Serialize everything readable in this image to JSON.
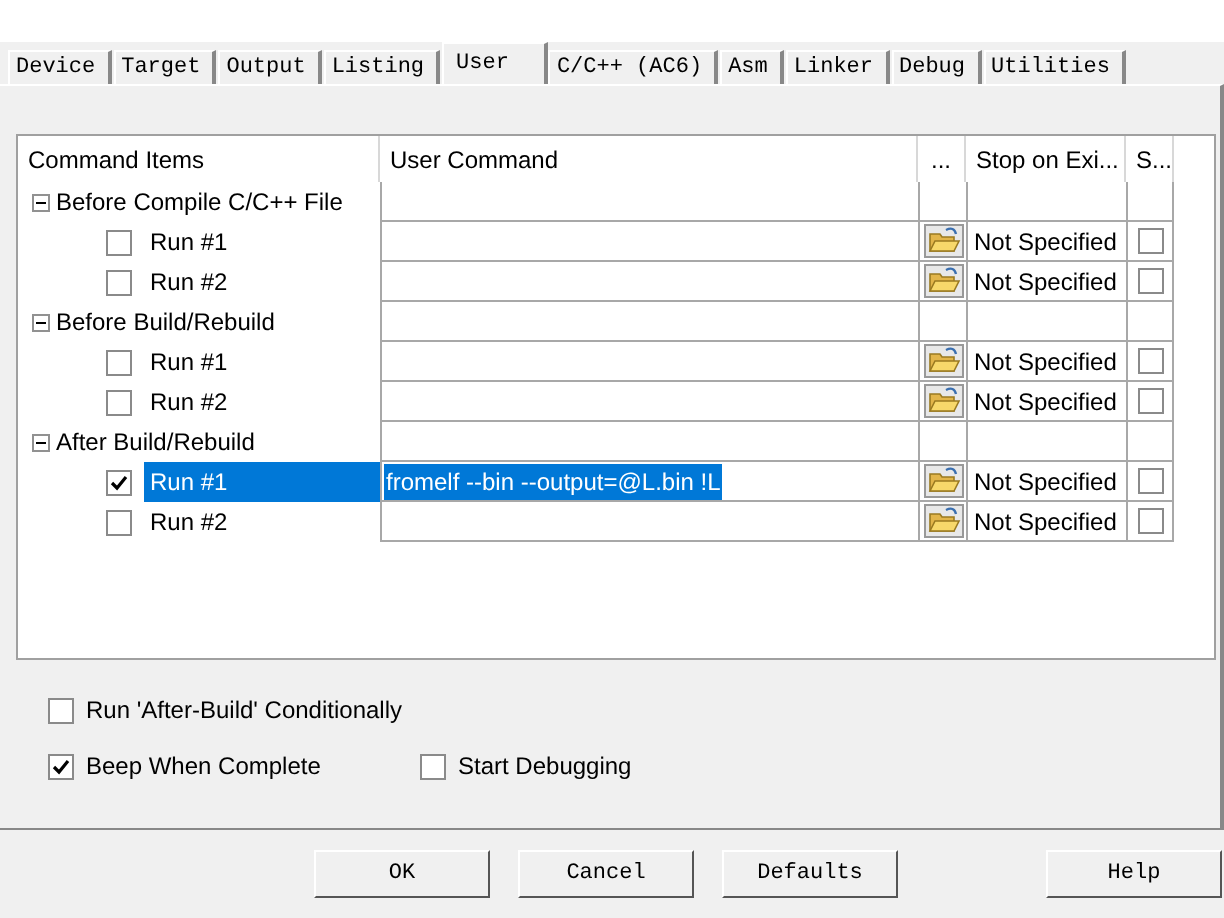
{
  "tabs": [
    {
      "label": "Device",
      "selected": false
    },
    {
      "label": "Target",
      "selected": false
    },
    {
      "label": "Output",
      "selected": false
    },
    {
      "label": "Listing",
      "selected": false
    },
    {
      "label": "User",
      "selected": true
    },
    {
      "label": "C/C++ (AC6)",
      "selected": false
    },
    {
      "label": "Asm",
      "selected": false
    },
    {
      "label": "Linker",
      "selected": false
    },
    {
      "label": "Debug",
      "selected": false
    },
    {
      "label": "Utilities",
      "selected": false
    }
  ],
  "table": {
    "columns": [
      "Command Items",
      "User Command",
      "...",
      "Stop on Exi...",
      "S..."
    ],
    "groups": [
      {
        "label": "Before Compile C/C++ File",
        "expanded": true,
        "children": [
          {
            "label": "Run #1",
            "checked": false,
            "selected": false,
            "stop_on_exit": "Not Specified",
            "s_checked": false
          },
          {
            "label": "Run #2",
            "checked": false,
            "selected": false,
            "stop_on_exit": "Not Specified",
            "s_checked": false
          }
        ]
      },
      {
        "label": "Before Build/Rebuild",
        "expanded": true,
        "children": [
          {
            "label": "Run #1",
            "checked": false,
            "selected": false,
            "stop_on_exit": "Not Specified",
            "s_checked": false
          },
          {
            "label": "Run #2",
            "checked": false,
            "selected": false,
            "stop_on_exit": "Not Specified",
            "s_checked": false
          }
        ]
      },
      {
        "label": "After Build/Rebuild",
        "expanded": true,
        "children": [
          {
            "label": "Run #1",
            "checked": true,
            "selected": true,
            "command": "fromelf --bin --output=@L.bin !L",
            "stop_on_exit": "Not Specified",
            "s_checked": false
          },
          {
            "label": "Run #2",
            "checked": false,
            "selected": false,
            "stop_on_exit": "Not Specified",
            "s_checked": false
          }
        ]
      }
    ]
  },
  "options": [
    [
      {
        "label": "Run 'After-Build' Conditionally",
        "checked": false
      }
    ],
    [
      {
        "label": "Beep When Complete",
        "checked": true
      },
      {
        "label": "Start Debugging",
        "checked": false
      }
    ]
  ],
  "buttons": [
    "OK",
    "Cancel",
    "Defaults",
    "Help"
  ]
}
